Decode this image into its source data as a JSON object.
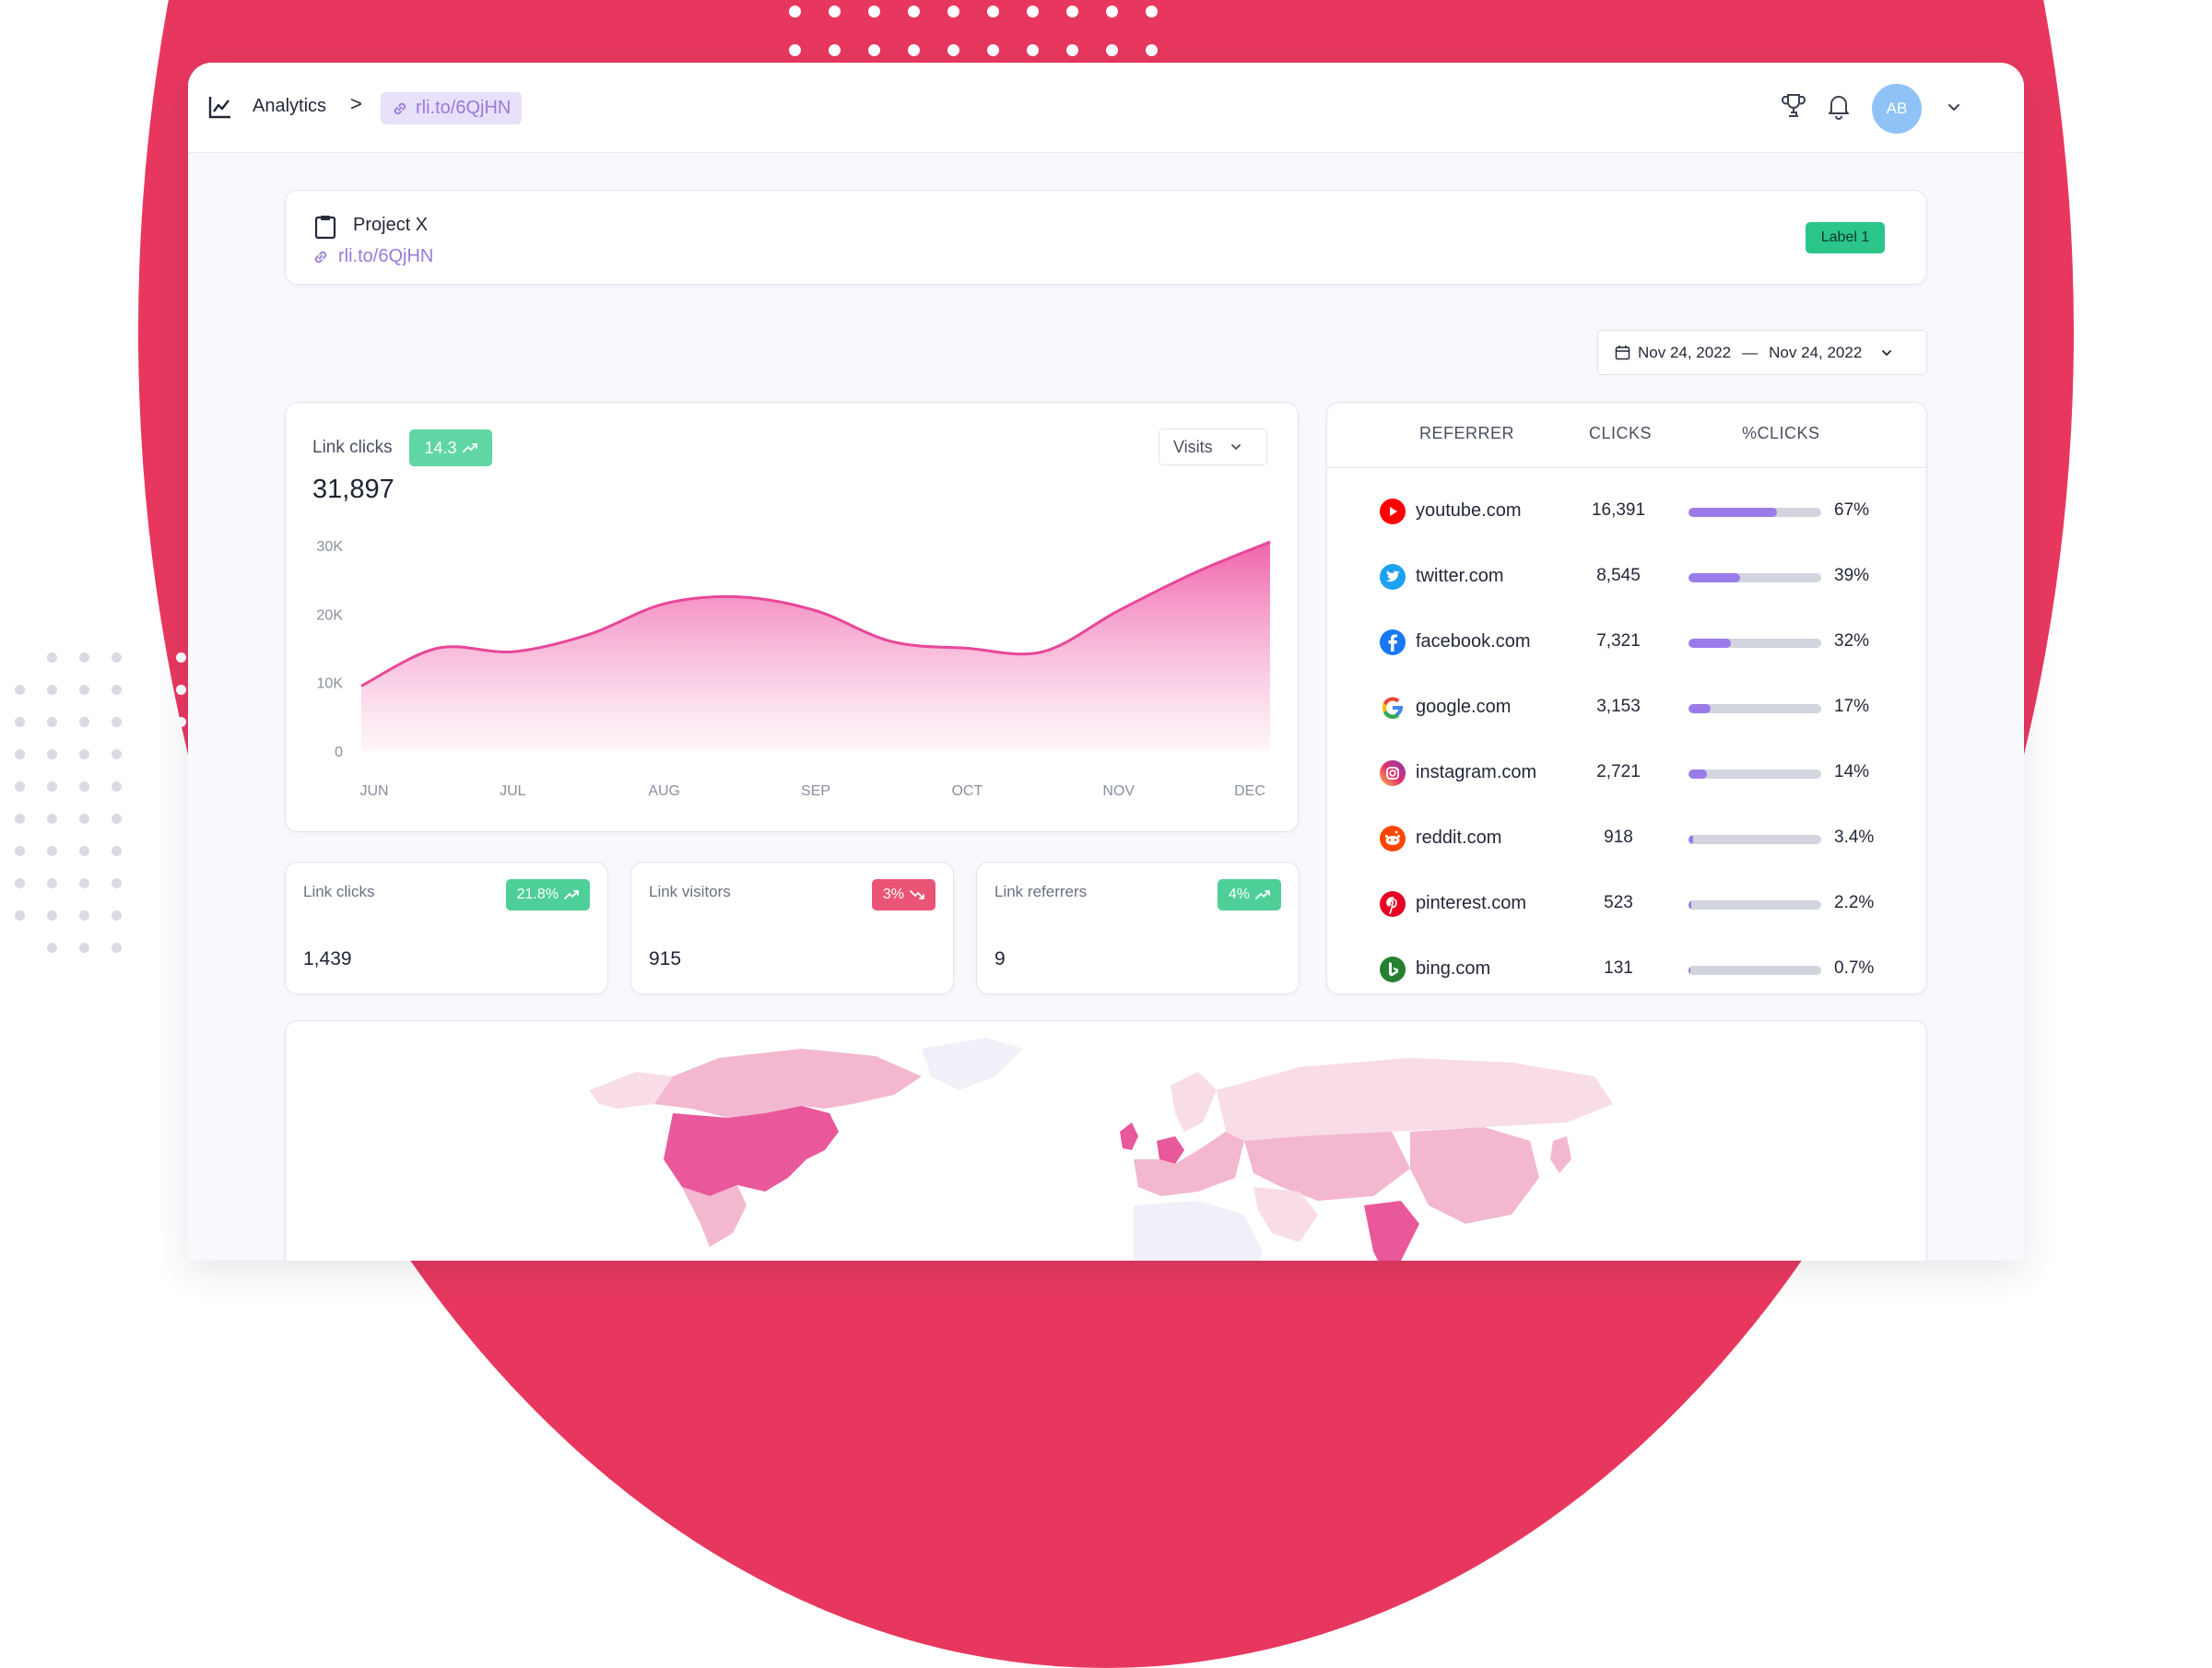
{
  "topbar": {
    "title": "Analytics",
    "separator": ">",
    "link": "rli.to/6QjHN",
    "avatar_initials": "AB",
    "icons": [
      "chart-line-icon",
      "link-icon",
      "trophy-icon",
      "bell-icon",
      "chevron-down-icon"
    ]
  },
  "project": {
    "name": "Project X",
    "link": "rli.to/6QjHN",
    "label": "Label 1"
  },
  "date_range": {
    "start": "Nov 24, 2022",
    "separator": "—",
    "end": "Nov 24, 2022"
  },
  "link_clicks_chart": {
    "label": "Link clicks",
    "badge": "14.3",
    "total": "31,897",
    "metric_select": "Visits"
  },
  "chart_data": {
    "type": "area",
    "title": "",
    "xlabel": "",
    "ylabel": "",
    "categories": [
      "JUN",
      "JUL",
      "AUG",
      "SEP",
      "OCT",
      "NOV",
      "DEC"
    ],
    "y_tick_labels": [
      "30K",
      "20K",
      "10K",
      "0"
    ],
    "y_ticks": [
      30000,
      20000,
      10000,
      0
    ],
    "ylim": [
      0,
      30000
    ],
    "grid": false,
    "x": [
      0,
      0.5,
      1,
      1.5,
      2,
      2.5,
      3,
      3.5,
      4,
      4.5,
      5,
      5.5,
      6
    ],
    "values": [
      9500,
      15000,
      14500,
      17000,
      21500,
      22500,
      20500,
      16000,
      15000,
      14500,
      20500,
      26000,
      32000
    ],
    "colors": {
      "line": "#e8479a",
      "fill_top": "#ef5ba6",
      "fill_bottom": "#fdf0f7"
    }
  },
  "stats": [
    {
      "label": "Link clicks",
      "badge": "21.8%",
      "trend": "up",
      "value": "1,439",
      "color": "#4fcf98"
    },
    {
      "label": "Link visitors",
      "badge": "3%",
      "trend": "down",
      "value": "915",
      "color": "#ea5477"
    },
    {
      "label": "Link referrers",
      "badge": "4%",
      "trend": "up",
      "value": "9",
      "color": "#4fcf98"
    }
  ],
  "referrers": {
    "headers": {
      "referrer": "REFERRER",
      "clicks": "CLICKS",
      "pct": "%CLICKS"
    },
    "rows": [
      {
        "name": "youtube.com",
        "clicks": "16,391",
        "pct": "67%",
        "share": 0.67,
        "icon": "youtube-icon",
        "bar": "#9b7bea"
      },
      {
        "name": "twitter.com",
        "clicks": "8,545",
        "pct": "39%",
        "share": 0.39,
        "icon": "twitter-icon",
        "bar": "#9b7bea"
      },
      {
        "name": "facebook.com",
        "clicks": "7,321",
        "pct": "32%",
        "share": 0.32,
        "icon": "facebook-icon",
        "bar": "#9b7bea"
      },
      {
        "name": "google.com",
        "clicks": "3,153",
        "pct": "17%",
        "share": 0.17,
        "icon": "google-icon",
        "bar": "#9b7bea"
      },
      {
        "name": "instagram.com",
        "clicks": "2,721",
        "pct": "14%",
        "share": 0.14,
        "icon": "instagram-icon",
        "bar": "#9b7bea"
      },
      {
        "name": "reddit.com",
        "clicks": "918",
        "pct": "3.4%",
        "share": 0.034,
        "icon": "reddit-icon",
        "bar": "#9b7bea"
      },
      {
        "name": "pinterest.com",
        "clicks": "523",
        "pct": "2.2%",
        "share": 0.022,
        "icon": "pinterest-icon",
        "bar": "#9b7bea"
      },
      {
        "name": "bing.com",
        "clicks": "131",
        "pct": "0.7%",
        "share": 0.007,
        "icon": "bing-icon",
        "bar": "#9b7bea"
      }
    ]
  },
  "map": {
    "icon": "world-map",
    "colors": {
      "high": "#e8589a",
      "mid": "#f3b7cf",
      "low": "#f8dce8",
      "none": "#f1eff8"
    }
  },
  "theme": {
    "accent_red": "#e8375f",
    "link_purple": "#9a7ad9",
    "label_green": "#2bc58a"
  }
}
